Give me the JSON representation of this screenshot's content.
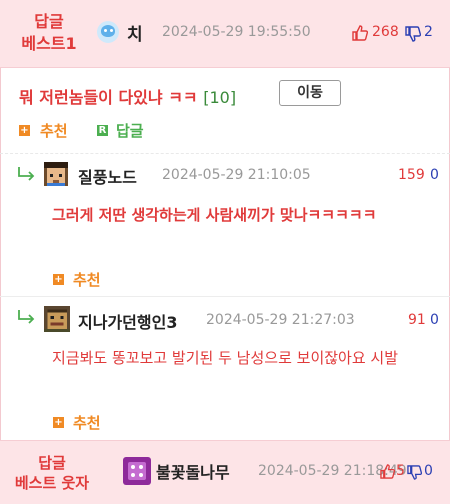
{
  "best_header": {
    "label_line1": "답글",
    "label_line2": "베스트1",
    "username": "치",
    "datetime": "2024-05-29 19:55:50",
    "upvotes": "268",
    "downvotes": "2"
  },
  "post": {
    "title": "뭐 저런놈들이 다있냐 ㅋㅋ",
    "comment_count": "[10]",
    "move_button": "이동",
    "recommend_label": "추천",
    "reply_label": "답글",
    "reply_icon_letter": "R"
  },
  "comments": [
    {
      "username": "질풍노드",
      "datetime": "2024-05-29 21:10:05",
      "upvotes": "159",
      "downvotes": "0",
      "text": "그러게 저딴 생각하는게 사람새끼가 맞나ㅋㅋㅋㅋㅋ",
      "recommend_label": "추천"
    },
    {
      "username": "지나가던행인3",
      "datetime": "2024-05-29 21:27:03",
      "upvotes": "91",
      "downvotes": "0",
      "text": "지금봐도 똥꼬보고 발기된 두 남성으로 보이잖아요 시발",
      "recommend_label": "추천"
    }
  ],
  "bottom_best": {
    "label_line1": "답글",
    "label_line2": "베스트 웃자",
    "username": "불꽃돌나무",
    "datetime": "2024-05-29 21:18:49",
    "upvotes": "5",
    "downvotes": "0"
  },
  "colors": {
    "accent_red": "#e03a3a",
    "down_blue": "#2b3fb3",
    "header_pink": "#fde4e7",
    "recommend_orange": "#f08a24",
    "reply_green": "#4caf50"
  }
}
